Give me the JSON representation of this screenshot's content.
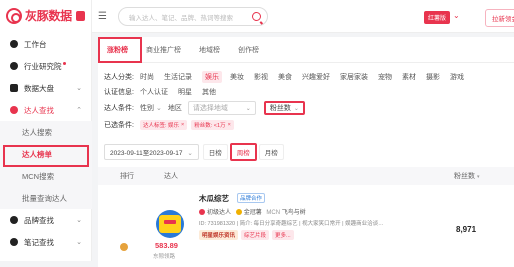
{
  "app": {
    "logo_text": "灰豚数据"
  },
  "sidebar": {
    "items": [
      {
        "label": "工作台",
        "icon": "workbench-icon"
      },
      {
        "label": "行业研究院",
        "icon": "research-icon",
        "badge": "dot"
      },
      {
        "label": "数据大盘",
        "icon": "dashboard-icon"
      },
      {
        "label": "达人查找",
        "icon": "search-person-icon",
        "expanded": true
      },
      {
        "label": "品牌查找",
        "icon": "brand-icon"
      },
      {
        "label": "笔记查找",
        "icon": "note-icon"
      }
    ],
    "subitems": [
      {
        "label": "达人搜索"
      },
      {
        "label": "达人榜单",
        "active": true
      },
      {
        "label": "MCN搜索"
      },
      {
        "label": "批量查询达人"
      }
    ]
  },
  "topbar": {
    "search_placeholder": "输入达人、笔记、品牌、热词等搜索",
    "vip_label": "红薯版",
    "promo_label": "拉新领会员"
  },
  "tabs": [
    "涨粉榜",
    "商业推广榜",
    "地域榜",
    "创作榜"
  ],
  "filters": {
    "category": {
      "label": "达人分类:",
      "options": [
        "时尚",
        "生活记录",
        "娱乐",
        "美妆",
        "影视",
        "美食",
        "兴趣爱好",
        "家居家装",
        "宠物",
        "素材",
        "摄影",
        "游戏"
      ],
      "selected": "娱乐"
    },
    "certification": {
      "label": "认证信息:",
      "options": [
        "个人认证",
        "明星",
        "其他"
      ]
    },
    "conditions": {
      "label": "达人条件:",
      "gender": "性别",
      "region": "地区",
      "region_placeholder": "请选择地域",
      "fans": "粉丝数"
    },
    "selected_conditions": {
      "label": "已选条件:",
      "chips": [
        "达人标签: 娱乐",
        "粉丝数: <1万"
      ]
    }
  },
  "date": {
    "range": "2023-09-11至2023-09-17",
    "periods": [
      "日榜",
      "周榜",
      "月榜"
    ],
    "selected_period": "周榜"
  },
  "table": {
    "headers": {
      "rank": "排行",
      "creator": "达人",
      "fans": "粉丝数"
    },
    "rows": [
      {
        "name": "木瓜综艺",
        "brand_tag": "品牌合作",
        "level": "初级达人",
        "rank_label": "金冠薯",
        "mcn": "飞鸟与树",
        "id_line": "ID: 731981320 | 简介: 每日分享奇趣综艺 | 视大家笑口常开 | 娱趣商业洽谈…",
        "score": "583.89",
        "region": "东隙领路",
        "tags": [
          "明星娱乐资讯",
          "综艺片段",
          "更多..."
        ],
        "fans": "8,971"
      }
    ]
  }
}
